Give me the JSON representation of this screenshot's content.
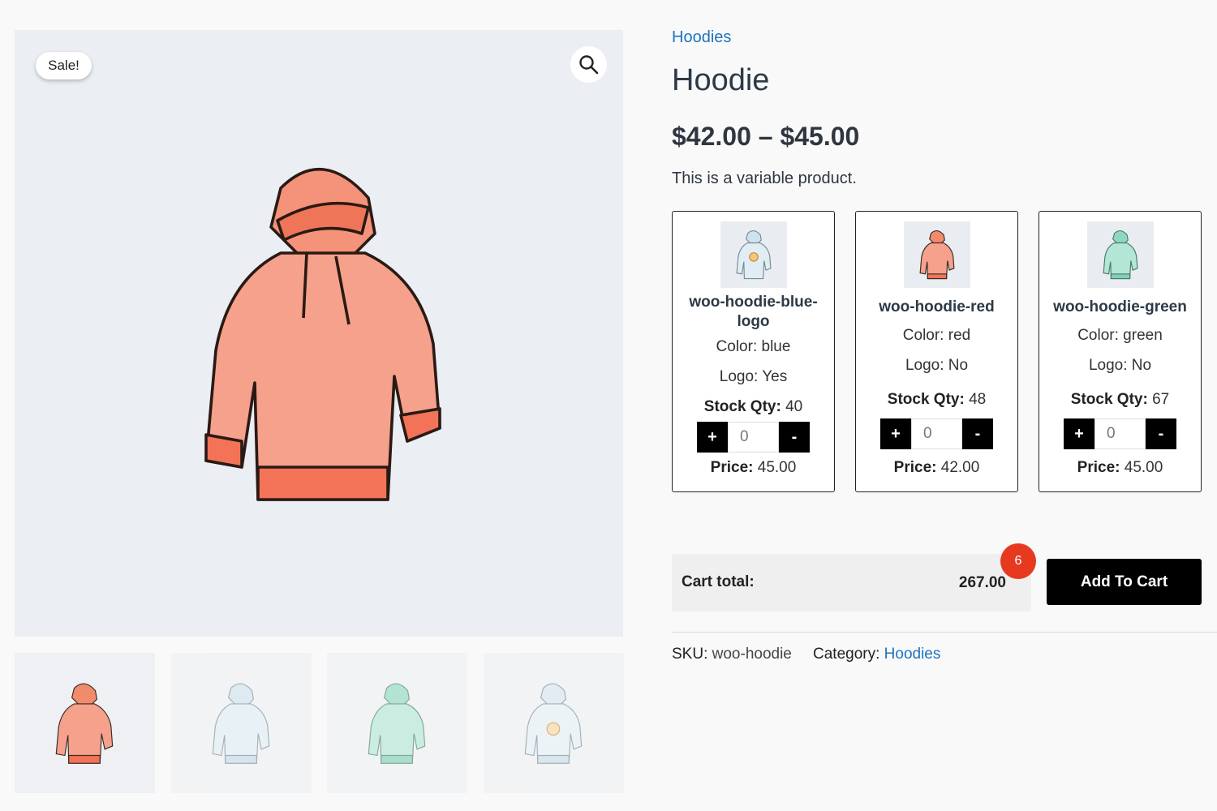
{
  "gallery": {
    "sale_badge": "Sale!",
    "zoom_icon": "magnifier-icon",
    "thumbnails": [
      {
        "name": "red-hoodie",
        "color": "#f28b6c"
      },
      {
        "name": "blue-hoodie",
        "color": "#cfe3ee"
      },
      {
        "name": "green-hoodie",
        "color": "#8fd8c0"
      },
      {
        "name": "blue-logo-hoodie",
        "color": "#d7e6ef"
      }
    ]
  },
  "product": {
    "breadcrumb": "Hoodies",
    "title": "Hoodie",
    "price_range": "$42.00 – $45.00",
    "description": "This is a variable product."
  },
  "variants": [
    {
      "name": "woo-hoodie-blue-logo",
      "color_label": "Color:",
      "color": "blue",
      "logo_label": "Logo:",
      "logo": "Yes",
      "stock_label": "Stock Qty:",
      "stock": "40",
      "qty": "0",
      "price_label": "Price:",
      "price": "45.00",
      "plus": "+",
      "minus": "-"
    },
    {
      "name": "woo-hoodie-red",
      "color_label": "Color:",
      "color": "red",
      "logo_label": "Logo:",
      "logo": "No",
      "stock_label": "Stock Qty:",
      "stock": "48",
      "qty": "0",
      "price_label": "Price:",
      "price": "42.00",
      "plus": "+",
      "minus": "-"
    },
    {
      "name": "woo-hoodie-green",
      "color_label": "Color:",
      "color": "green",
      "logo_label": "Logo:",
      "logo": "No",
      "stock_label": "Stock Qty:",
      "stock": "67",
      "qty": "0",
      "price_label": "Price:",
      "price": "45.00",
      "plus": "+",
      "minus": "-"
    }
  ],
  "cart": {
    "label": "Cart total:",
    "value": "267.00",
    "count": "6",
    "add_button": "Add To Cart"
  },
  "meta": {
    "sku_label": "SKU:",
    "sku": "woo-hoodie",
    "category_label": "Category:",
    "category": "Hoodies"
  },
  "colors": {
    "link": "#1e73be",
    "badge": "#e6391f",
    "hoodie_red": "#f28b6c",
    "hoodie_blue": "#cfe3ee",
    "hoodie_green": "#8fd8c0"
  }
}
